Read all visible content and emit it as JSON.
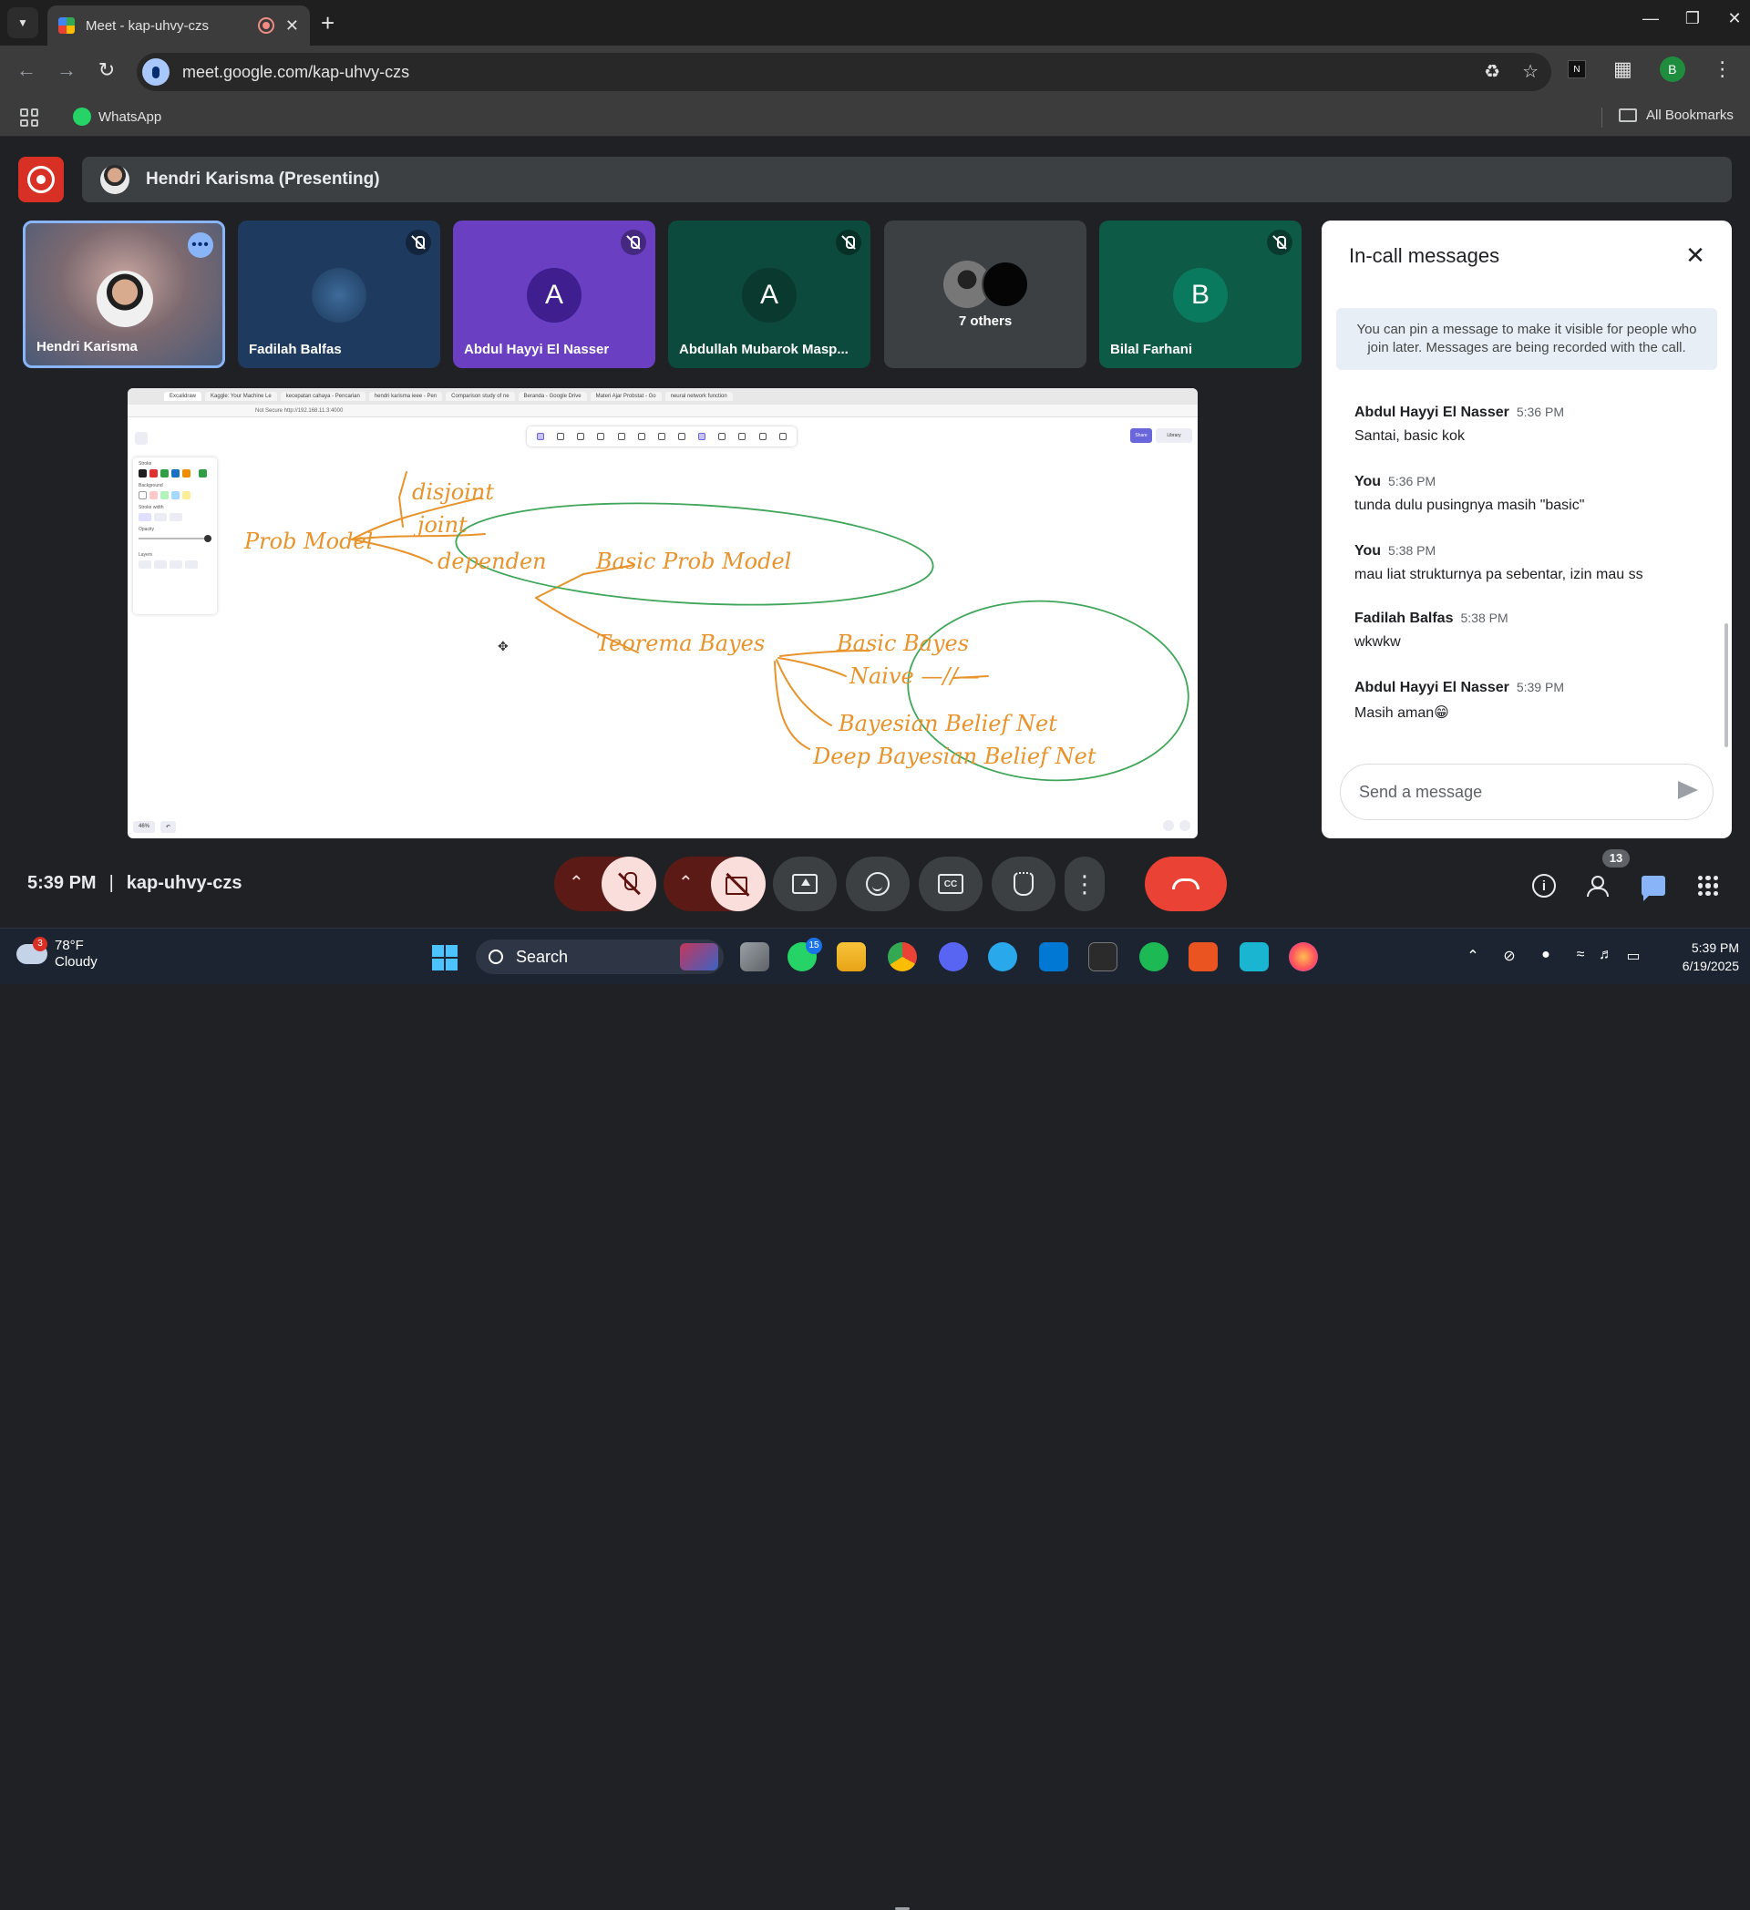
{
  "browser": {
    "tab_title": "Meet - kap-uhvy-czs",
    "url": "meet.google.com/kap-uhvy-czs",
    "profile_initial": "B",
    "bookmarks": [
      {
        "label": "WhatsApp"
      }
    ],
    "all_bookmarks_label": "All Bookmarks"
  },
  "meet": {
    "presenting_label": "Hendri Karisma (Presenting)",
    "participants": [
      {
        "name": "Hendri Karisma",
        "initial": "",
        "muted": false
      },
      {
        "name": "Fadilah Balfas",
        "initial": "",
        "muted": true
      },
      {
        "name": "Abdul Hayyi El Nasser",
        "initial": "A",
        "muted": true
      },
      {
        "name": "Abdullah Mubarok Masp...",
        "initial": "A",
        "muted": true
      },
      {
        "name": "7 others",
        "initial": "",
        "muted": false
      },
      {
        "name": "Bilal Farhani",
        "initial": "B",
        "muted": true
      }
    ],
    "meeting_time": "5:39 PM",
    "meeting_code": "kap-uhvy-czs",
    "people_count": "13",
    "colors": {
      "end_call": "#ea4335",
      "record": "#d93025",
      "accent": "#8ab4f8"
    }
  },
  "shared_screen": {
    "browser_tabs": [
      "Excalidraw",
      "Kaggle: Your Machine Le",
      "kecepatan cahaya - Pencarian",
      "hendri karisma ieee - Pen",
      "Comparison study of ne",
      "Beranda - Google Drive",
      "Materi Ajar Probstat - Go",
      "neural network function"
    ],
    "address": "Not Secure   http://192.168.11.3:4000",
    "share_label": "Share",
    "library_label": "Library",
    "zoom_label": "46%",
    "props_labels": {
      "stroke": "Stroke",
      "background": "Background",
      "stroke_width": "Stroke width",
      "opacity": "Opacity",
      "layers": "Layers"
    },
    "handwriting": {
      "prob_model": "Prob Model",
      "disjoint": "disjoint",
      "joint": "joint",
      "dependen": "dependen",
      "basic_prob_model": "Basic Prob Model",
      "teorema_bayes": "Teorema Bayes",
      "basic_bayes": "Basic Bayes",
      "naive": "Naive  —//—",
      "bbn": "Bayesian Belief Net",
      "dbbn": "Deep Bayesian Belief Net"
    }
  },
  "chat": {
    "title": "In-call messages",
    "pin_note": "You can pin a message to make it visible for people who join later. Messages are being recorded with the call.",
    "messages": [
      {
        "sender": "Abdul Hayyi El Nasser",
        "time": "5:36 PM",
        "text": "Santai, basic kok"
      },
      {
        "sender": "You",
        "time": "5:36 PM",
        "text": "tunda dulu pusingnya masih \"basic\""
      },
      {
        "sender": "You",
        "time": "5:38 PM",
        "text": "mau liat strukturnya pa sebentar, izin mau ss"
      },
      {
        "sender": "Fadilah Balfas",
        "time": "5:38 PM",
        "text": "wkwkw"
      },
      {
        "sender": "Abdul Hayyi El Nasser",
        "time": "5:39 PM",
        "text": "Masih aman😁"
      }
    ],
    "input_placeholder": "Send a message"
  },
  "taskbar": {
    "weather_badge": "3",
    "temperature": "78°F",
    "condition": "Cloudy",
    "search_label": "Search",
    "whatsapp_badge": "15",
    "time": "5:39 PM",
    "date": "6/19/2025"
  }
}
